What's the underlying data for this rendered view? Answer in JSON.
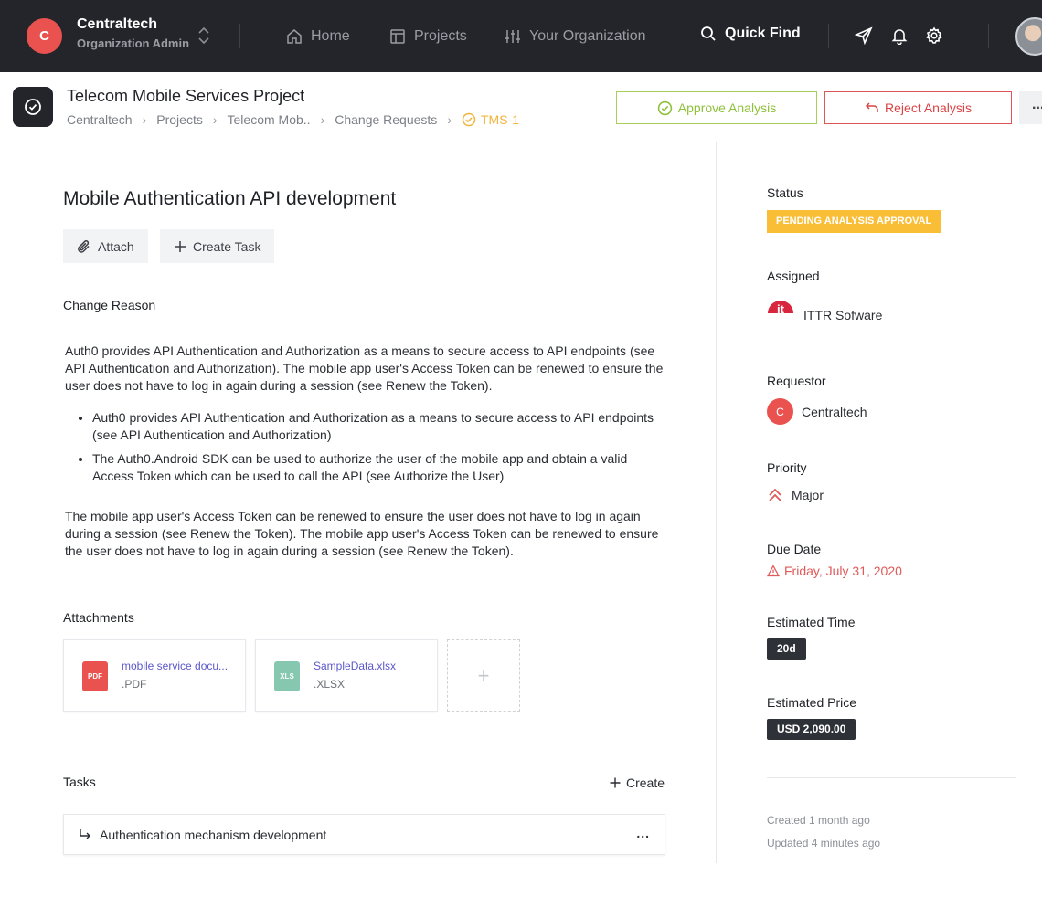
{
  "org": {
    "initial": "C",
    "name": "Centraltech",
    "role": "Organization Admin"
  },
  "nav": {
    "home": "Home",
    "projects": "Projects",
    "organization": "Your Organization",
    "quick_find": "Quick Find"
  },
  "project": {
    "title": "Telecom Mobile Services Project",
    "breadcrumb": [
      "Centraltech",
      "Projects",
      "Telecom Mob..",
      "Change Requests"
    ],
    "current_id": "TMS-1"
  },
  "actions": {
    "approve": "Approve Analysis",
    "reject": "Reject Analysis",
    "more": "..."
  },
  "main": {
    "title": "Mobile Authentication API development",
    "attach_label": "Attach",
    "create_task_label": "Create Task",
    "change_reason_label": "Change Reason",
    "description": {
      "p1": "Auth0 provides API Authentication and Authorization as a means to secure access to API endpoints (see API Authentication and Authorization). The mobile app user's Access Token can be renewed to ensure the user does not have to log in again during a session (see Renew the Token).",
      "bullets": [
        "Auth0 provides API Authentication and Authorization as a means to secure access to API endpoints (see API Authentication and Authorization)",
        "The Auth0.Android SDK can be used to authorize the user of the mobile app and obtain a valid Access Token which can be used to call the API (see Authorize the User)"
      ],
      "p2": "The mobile app user's Access Token can be renewed to ensure the user does not have to log in again during a session (see Renew the Token). The mobile app user's Access Token can be renewed to ensure the user does not have to log in again during a session (see Renew the Token)."
    },
    "attachments_label": "Attachments",
    "attachments": [
      {
        "badge": "PDF",
        "name": "mobile service docu...",
        "ext": ".PDF",
        "color": "#e9524f"
      },
      {
        "badge": "XLS",
        "name": "SampleData.xlsx",
        "ext": ".XLSX",
        "color": "#86c7b0"
      }
    ],
    "add_attachment": "+",
    "tasks_label": "Tasks",
    "tasks_create": "Create",
    "tasks": [
      {
        "title": "Authentication mechanism development",
        "more": "..."
      }
    ]
  },
  "side": {
    "status_label": "Status",
    "status_value": "PENDING ANALYSIS APPROVAL",
    "assigned_label": "Assigned",
    "assigned_value": "ITTR Sofware",
    "assigned_logo_text": "it",
    "requestor_label": "Requestor",
    "requestor_initial": "C",
    "requestor_value": "Centraltech",
    "priority_label": "Priority",
    "priority_value": "Major",
    "due_label": "Due Date",
    "due_value": "Friday, July 31, 2020",
    "est_time_label": "Estimated Time",
    "est_time_value": "20d",
    "est_price_label": "Estimated Price",
    "est_price_value": "USD 2,090.00",
    "created": "Created 1 month ago",
    "updated": "Updated 4 minutes ago"
  },
  "colors": {
    "accent_red": "#e9524f",
    "approve_green": "#8fc13b",
    "status_yellow": "#f9bd36",
    "nav_bg": "#23252b"
  }
}
